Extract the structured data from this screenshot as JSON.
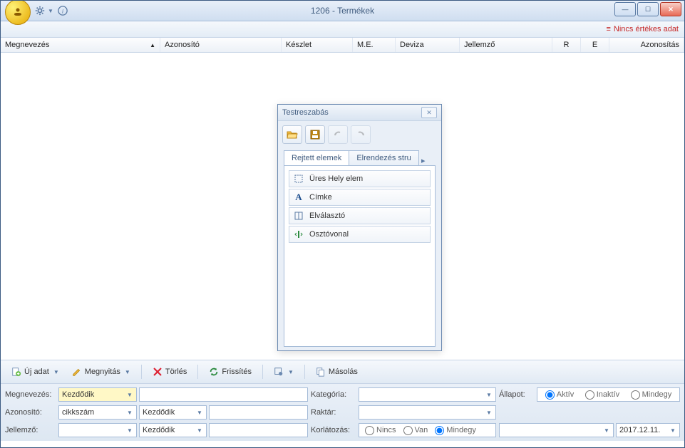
{
  "window": {
    "title": "1206 - Termékek"
  },
  "info": {
    "warning": "Nincs értékes adat"
  },
  "columns": [
    "Megnevezés",
    "Azonosító",
    "Készlet",
    "M.E.",
    "Deviza",
    "Jellemző",
    "R",
    "E",
    "Azonosítás"
  ],
  "toolbar": {
    "new": "Új adat",
    "open": "Megnyitás",
    "delete": "Törlés",
    "refresh": "Frissítés",
    "copy": "Másolás"
  },
  "filters": {
    "megnevezes_label": "Megnevezés:",
    "megnevezes_mode": "Kezdődik",
    "azonosito_label": "Azonosító:",
    "azonosito_type": "cikkszám",
    "azonosito_mode": "Kezdődik",
    "jellemzo_label": "Jellemző:",
    "jellemzo_mode": "Kezdődik",
    "kategoria_label": "Kategória:",
    "raktar_label": "Raktár:",
    "korlatozas_label": "Korlátozás:",
    "korl_nincs": "Nincs",
    "korl_van": "Van",
    "korl_mindegy": "Mindegy",
    "allapot_label": "Állapot:",
    "allapot_aktiv": "Aktív",
    "allapot_inaktiv": "Inaktív",
    "allapot_mindegy": "Mindegy",
    "date": "2017.12.11."
  },
  "dialog": {
    "title": "Testreszabás",
    "tab1": "Rejtett elemek",
    "tab2": "Elrendezés stru",
    "items": [
      {
        "icon": "empty",
        "label": "Üres Hely elem"
      },
      {
        "icon": "label",
        "label": "Címke"
      },
      {
        "icon": "sep",
        "label": "Elválasztó"
      },
      {
        "icon": "split",
        "label": "Osztóvonal"
      }
    ]
  }
}
